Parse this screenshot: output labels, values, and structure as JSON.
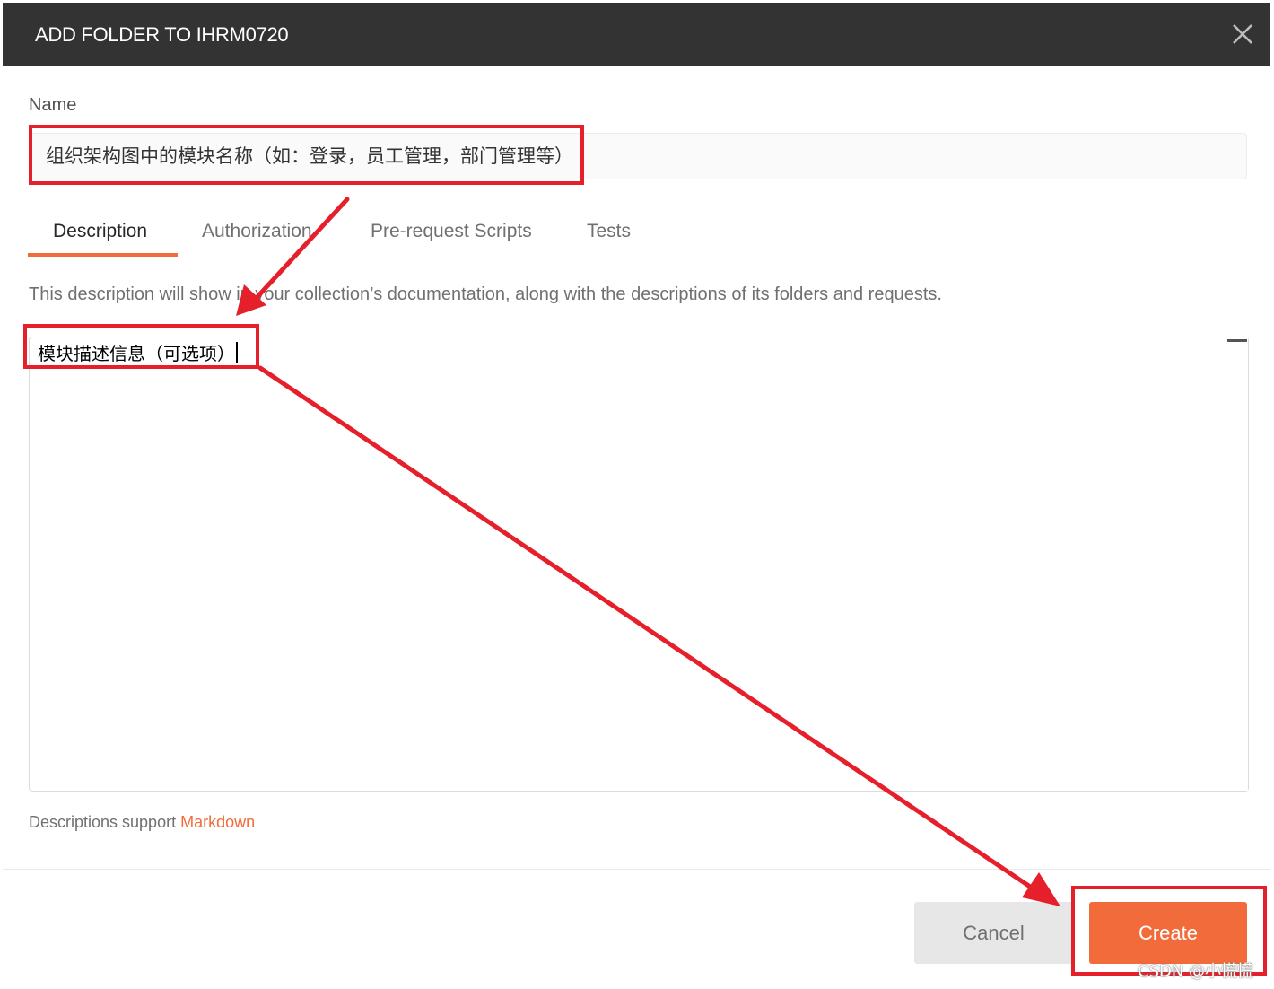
{
  "modal": {
    "title": "ADD FOLDER TO IHRM0720",
    "close_icon": "close-icon"
  },
  "form": {
    "name_label": "Name",
    "name_value": "组织架构图中的模块名称（如：登录，员工管理，部门管理等）"
  },
  "tabs": [
    {
      "label": "Description",
      "active": true
    },
    {
      "label": "Authorization",
      "active": false
    },
    {
      "label": "Pre-request Scripts",
      "active": false
    },
    {
      "label": "Tests",
      "active": false
    }
  ],
  "description": {
    "help_text": "This description will show in your collection’s documentation, along with the descriptions of its folders and requests.",
    "value": "模块描述信息（可选项）",
    "markdown_note": "Descriptions support",
    "markdown_link": "Markdown"
  },
  "buttons": {
    "cancel": "Cancel",
    "create": "Create"
  },
  "watermark": "CSDN @小慌慌",
  "colors": {
    "header_bg": "#333333",
    "accent": "#f26b3a",
    "annotation": "#e5202b"
  }
}
